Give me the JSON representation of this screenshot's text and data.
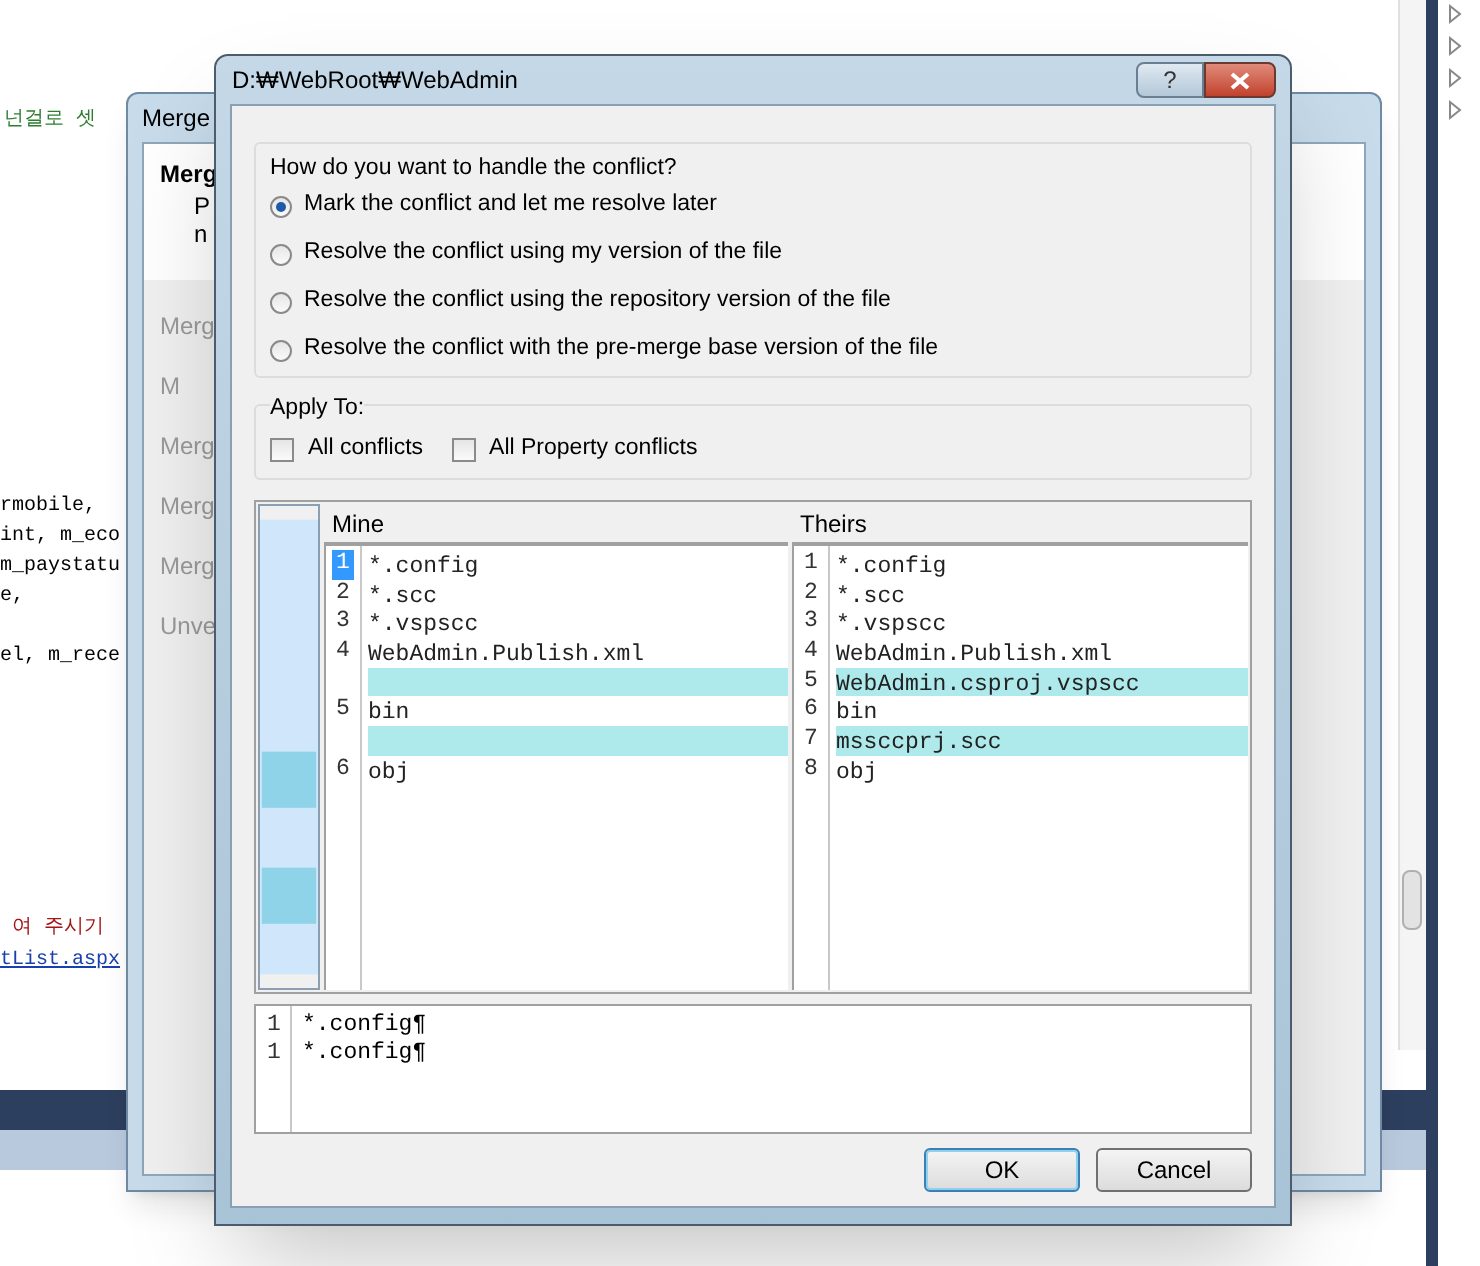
{
  "editor": {
    "comment_line": "넌걸로 셋",
    "code_blocks": [
      [
        "rmobile,",
        "int, m_eco",
        "m_paystatu",
        "e,"
      ],
      [
        "el, m_rece"
      ]
    ],
    "message_line": "여 주시기",
    "link_line": "tList.aspx"
  },
  "background_window": {
    "title": "Merge",
    "heading": "Merg",
    "description_lines": [
      "P",
      "n"
    ],
    "group_labels": [
      "Merg",
      "M",
      "Merg",
      "Merg",
      "Merg",
      "Unve"
    ]
  },
  "dialog": {
    "title": "D:₩WebRoot₩WebAdmin",
    "help": "?",
    "conflict_group": {
      "label": "How do you want to handle the conflict?",
      "options": [
        {
          "label": "Mark the conflict and let me resolve later",
          "selected": true
        },
        {
          "label": "Resolve the conflict using my version of the file",
          "selected": false
        },
        {
          "label": "Resolve the conflict using the repository version of the file",
          "selected": false
        },
        {
          "label": "Resolve the conflict with the pre-merge base version of the file",
          "selected": false
        }
      ]
    },
    "apply_to": {
      "label": "Apply To:",
      "options": [
        {
          "label": "All conflicts",
          "checked": false
        },
        {
          "label": "All Property conflicts",
          "checked": false
        }
      ]
    },
    "mine": {
      "title": "Mine",
      "lines": [
        {
          "kind": "line",
          "number": "1",
          "text": "*.config",
          "selected": true
        },
        {
          "kind": "line",
          "number": "2",
          "text": "*.scc",
          "selected": false
        },
        {
          "kind": "line",
          "number": "3",
          "text": "*.vspscc",
          "selected": false
        },
        {
          "kind": "line",
          "number": "4",
          "text": "WebAdmin.Publish.xml",
          "selected": false
        },
        {
          "kind": "gap",
          "selected": false
        },
        {
          "kind": "line",
          "number": "5",
          "text": "bin",
          "selected": false
        },
        {
          "kind": "gap",
          "selected": false
        },
        {
          "kind": "line",
          "number": "6",
          "text": "obj",
          "selected": false
        }
      ]
    },
    "theirs": {
      "title": "Theirs",
      "lines": [
        {
          "kind": "line",
          "number": "1",
          "text": "*.config",
          "selected": false
        },
        {
          "kind": "line",
          "number": "2",
          "text": "*.scc",
          "selected": false
        },
        {
          "kind": "line",
          "number": "3",
          "text": "*.vspscc",
          "selected": false
        },
        {
          "kind": "line",
          "number": "4",
          "text": "WebAdmin.Publish.xml",
          "selected": false
        },
        {
          "kind": "changed",
          "number": "5",
          "text": "WebAdmin.csproj.vspscc",
          "selected": false
        },
        {
          "kind": "line",
          "number": "6",
          "text": "bin",
          "selected": false
        },
        {
          "kind": "changed",
          "number": "7",
          "text": "mssccprj.scc",
          "selected": false
        },
        {
          "kind": "line",
          "number": "8",
          "text": "obj",
          "selected": false
        }
      ]
    },
    "preview": {
      "lines": [
        {
          "number": "1",
          "text": "*.config¶"
        },
        {
          "number": "1",
          "text": "*.config¶"
        }
      ]
    },
    "buttons": [
      {
        "label": "OK",
        "default": true
      },
      {
        "label": "Cancel",
        "default": false
      }
    ]
  }
}
